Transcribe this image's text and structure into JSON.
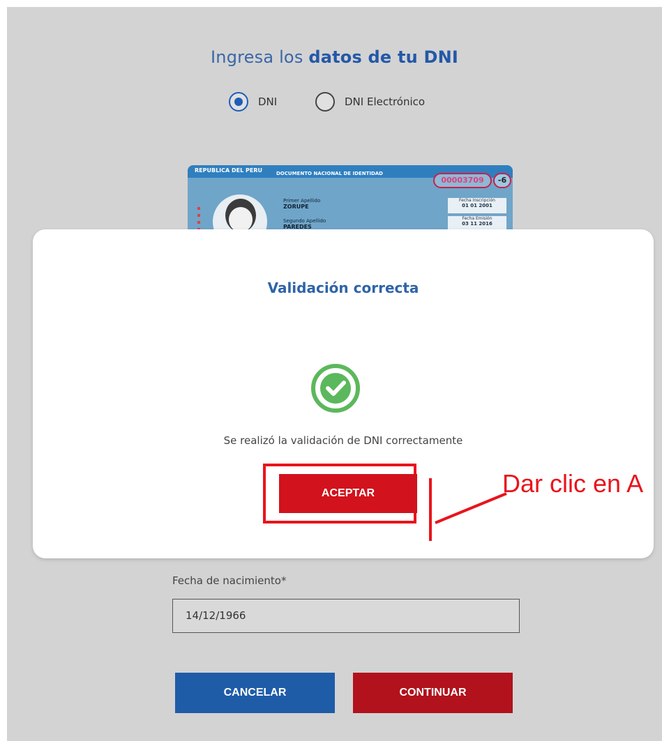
{
  "heading": {
    "prefix": "Ingresa los ",
    "bold": "datos de tu DNI"
  },
  "radios": [
    {
      "label": "DNI",
      "checked": true
    },
    {
      "label": "DNI Electrónico",
      "checked": false
    }
  ],
  "dni_card": {
    "country": "REPUBLICA DEL PERU",
    "doc_title": "DOCUMENTO NACIONAL DE IDENTIDAD",
    "number": "00003709",
    "check_digit": "-6",
    "surname1_label": "Primer Apellido",
    "surname1": "ZORUPE",
    "surname2_label": "Segundo Apellido",
    "surname2": "PAREDES",
    "issue_label": "Fecha Inscripción",
    "issue_date": "01 01 2001",
    "emission_label": "Fecha Emisión",
    "emission_date": "03 11 2016"
  },
  "form": {
    "birth_label": "Fecha de nacimiento*",
    "birth_value": "14/12/1966",
    "cancel": "CANCELAR",
    "continue": "CONTINUAR"
  },
  "modal": {
    "title": "Validación correcta",
    "message": "Se realizó la validación de DNI correctamente",
    "accept": "ACEPTAR",
    "icon": "check-circle-icon"
  },
  "annotation": {
    "text": "Dar clic en A"
  },
  "colors": {
    "primary_blue": "#1f5ca8",
    "danger_red": "#b1121c",
    "success_green": "#5cb85c",
    "annotation_red": "#e8141c"
  }
}
